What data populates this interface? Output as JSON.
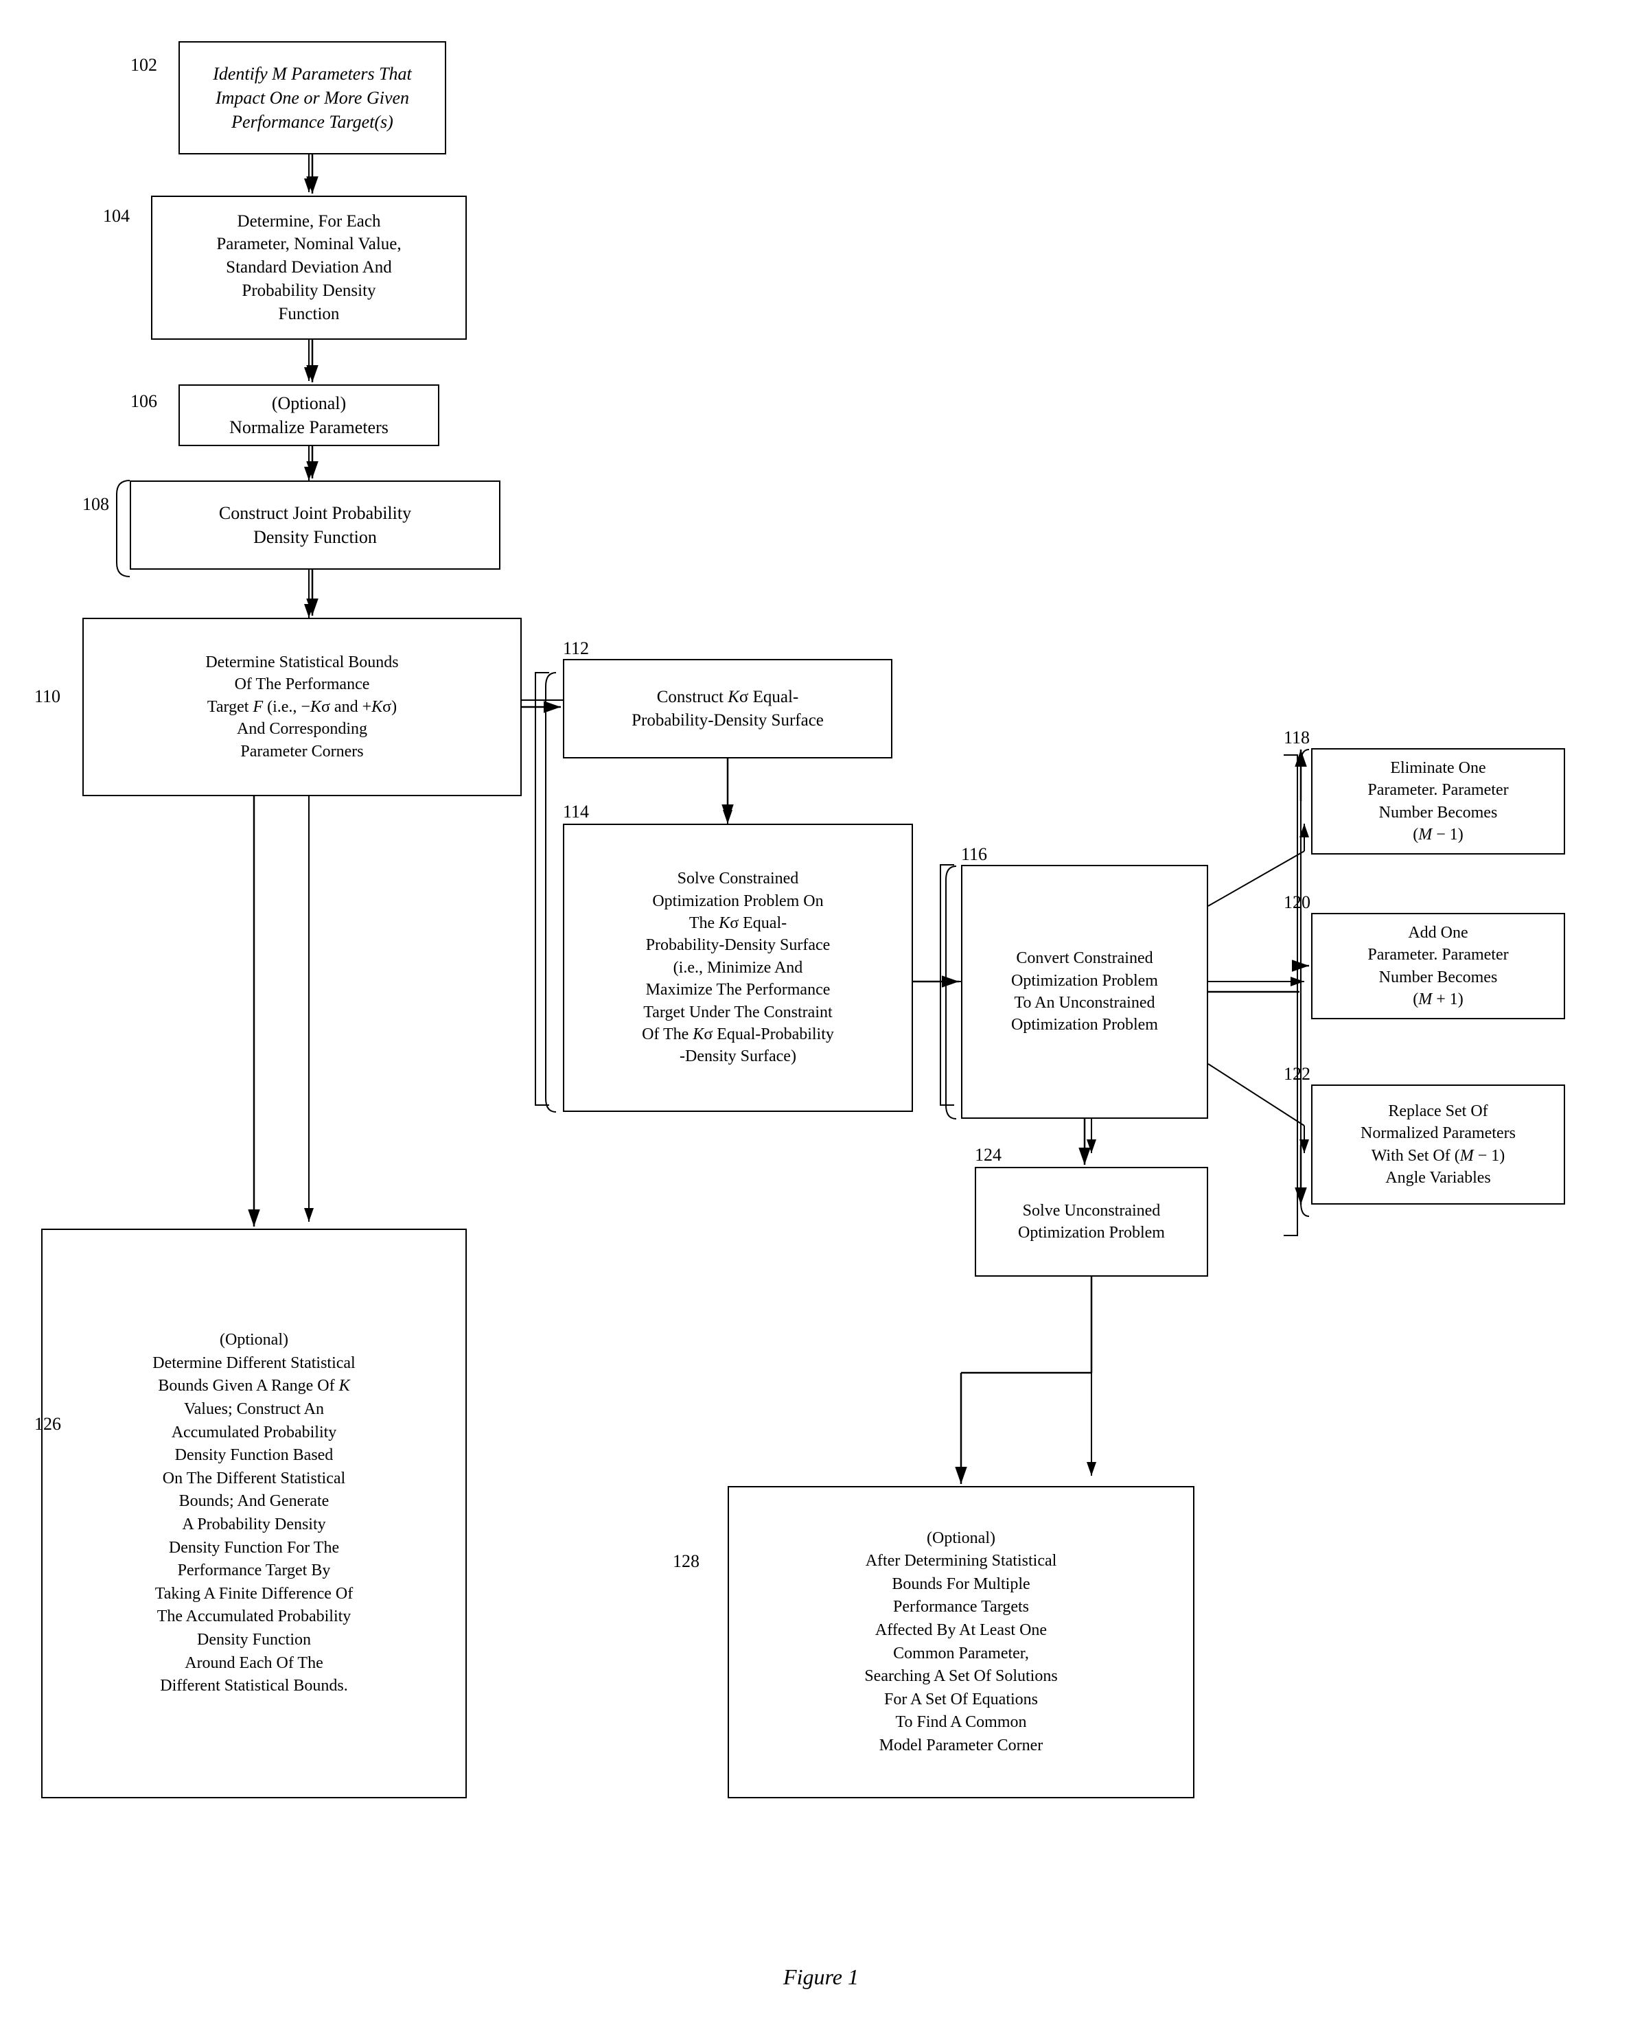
{
  "figure_caption": "Figure 1",
  "labels": {
    "l102": "102",
    "l104": "104",
    "l106": "106",
    "l108": "108",
    "l110": "110",
    "l112": "112",
    "l114": "114",
    "l116": "116",
    "l118": "118",
    "l120": "120",
    "l122": "122",
    "l124": "124",
    "l126": "126",
    "l128": "128"
  },
  "boxes": {
    "box102": "Identify M Parameters That\nImpact One or More\nGiven Performance Target(s)",
    "box104": "Determine, For Each\nParameter, Nominal Value,\nStandard Deviation And\nProbability Density\nFunction",
    "box106": "(Optional)\nNormalize Parameters",
    "box108": "Construct Joint Probability\nDensity Function",
    "box110_text": "Determine Statistical Bounds\nOf The Performance\nTarget F (i.e., −Kσ and +Kσ)\nAnd Corresponding\nParameter Corners",
    "box112": "Construct Kσ Equal-\nProbability-Density Surface",
    "box114": "Solve Constrained\nOptimization Problem On\nThe Kσ Equal-\nProbability-Density Surface\n(i.e., Minimize And\nMaximize The Performance\nTarget Under The Constraint\nOf The Kσ Equal-Probability\n-Density Surface)",
    "box116": "Convert Constrained\nOptimization Problem\nTo An Unconstrained\nOptimization Problem",
    "box118": "Eliminate One\nParameter. Parameter\nNumber Becomes\n(M − 1)",
    "box120": "Add One\nParameter. Parameter\nNumber Becomes\n(M + 1)",
    "box122": "Replace Set Of\nNormalized Parameters\nWith Set Of (M − 1)\nAngle Variables",
    "box124": "Solve Unconstrained\nOptimization Problem",
    "box126": "(Optional)\nDetermine Different Statistical\nBounds Given A Range Of K\nValues; Construct An\nAccumulated Probability\nDensity Function Based\nOn The Different Statistical\nBounds; And Generate\nA Probability Density\nDensity Function For The\nPerformance Target By\nTaking A Finite Difference Of\nThe Accumulated Probability\nDensity Function\nAround Each Of The\nDifferent Statistical Bounds.",
    "box128": "(Optional)\nAfter Determining Statistical\nBounds For Multiple\nPerformance Targets\nAffected By At Least One\nCommon Parameter,\nSearching A Set Of Solutions\nFor A Set Of Equations\nTo Find A Common\nModel Parameter Corner"
  }
}
